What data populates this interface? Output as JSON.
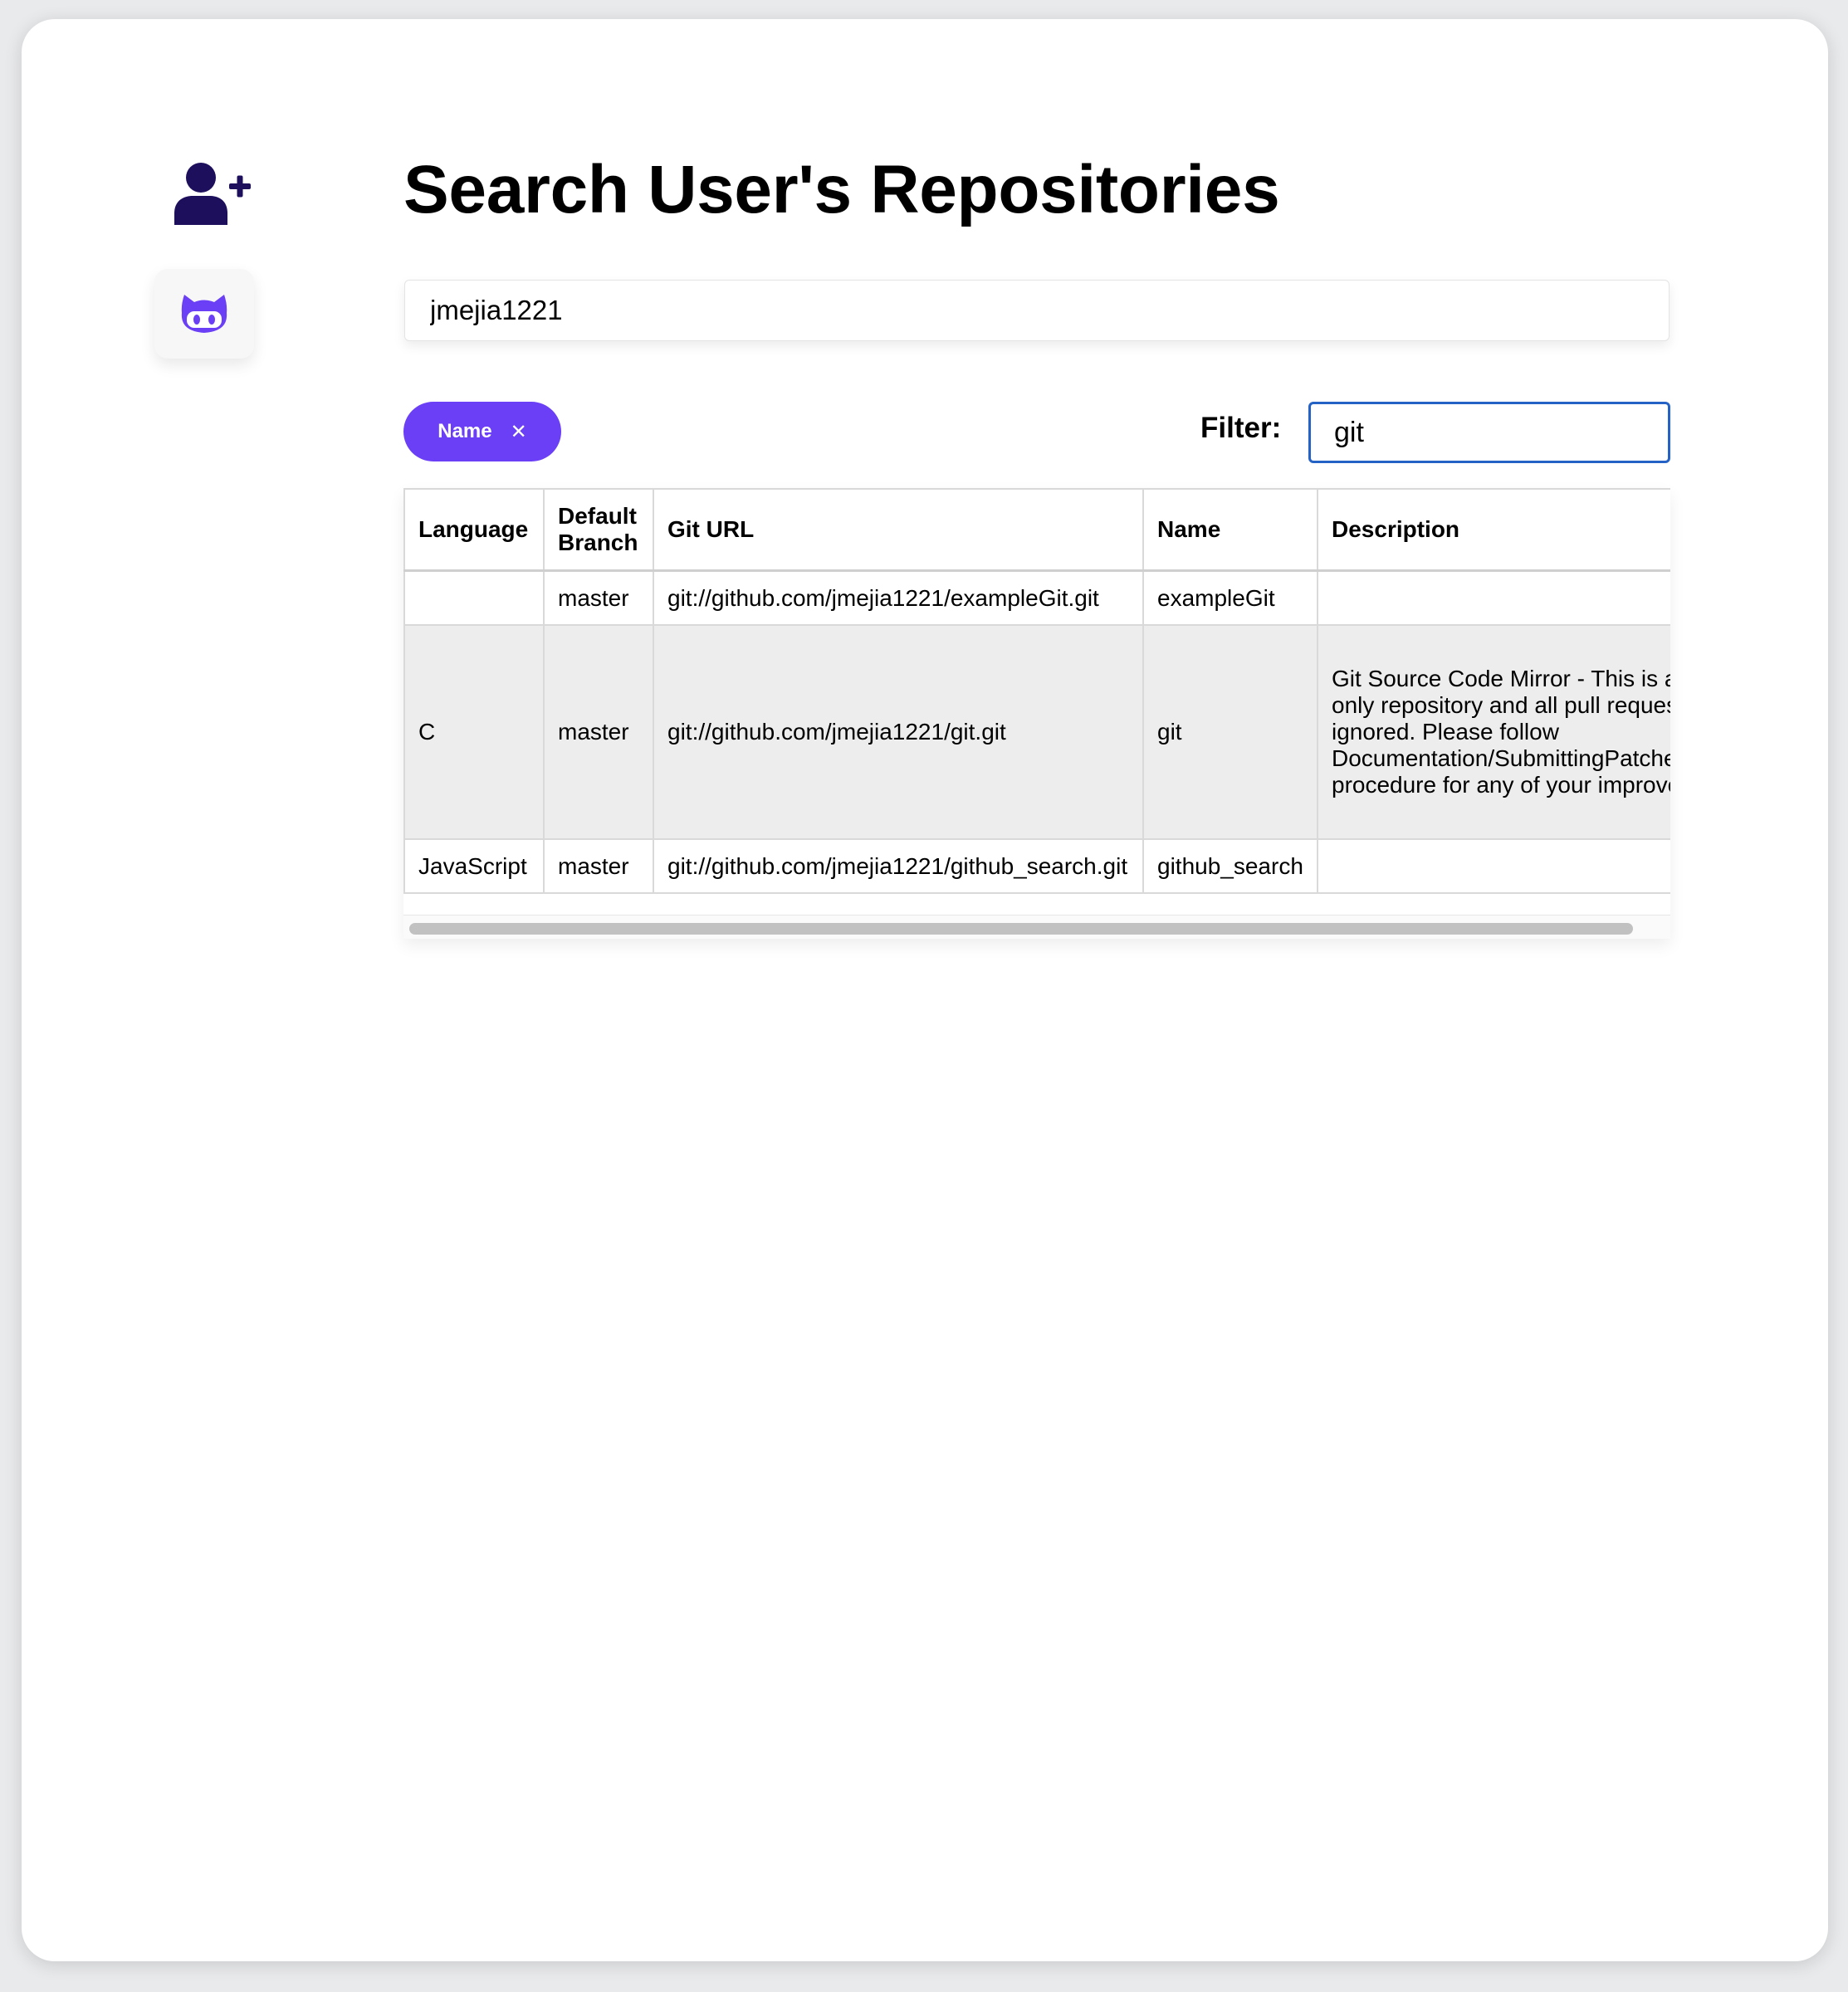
{
  "sidebar": {
    "add_user_icon": "user-plus-icon",
    "github_icon": "github-icon",
    "colors": {
      "add_user": "#1e0f5c",
      "github": "#6a3ff6"
    }
  },
  "main": {
    "title": "Search User's Repositories",
    "username_value": "jmejia1221",
    "filter_chip": {
      "label": "Name",
      "close_glyph": "✕"
    },
    "filter_label": "Filter:",
    "filter_value": "git"
  },
  "table": {
    "headers": [
      "Language",
      "Default Branch",
      "Git URL",
      "Name",
      "Description"
    ],
    "rows": [
      {
        "language": "",
        "branch": "master",
        "url": "git://github.com/jmejia1221/exampleGit.git",
        "name": "exampleGit",
        "description": ""
      },
      {
        "language": "C",
        "branch": "master",
        "url": "git://github.com/jmejia1221/git.git",
        "name": "git",
        "description": "Git Source Code Mirror - This is a publish-only repository and all pull requests are ignored. Please follow Documentation/SubmittingPatches procedure for any of your improvements."
      },
      {
        "language": "JavaScript",
        "branch": "master",
        "url": "git://github.com/jmejia1221/github_search.git",
        "name": "github_search",
        "description": ""
      }
    ]
  },
  "colors": {
    "accent": "#6a3ff6",
    "focus_border": "#2463c5",
    "striped_row": "#ededed"
  }
}
